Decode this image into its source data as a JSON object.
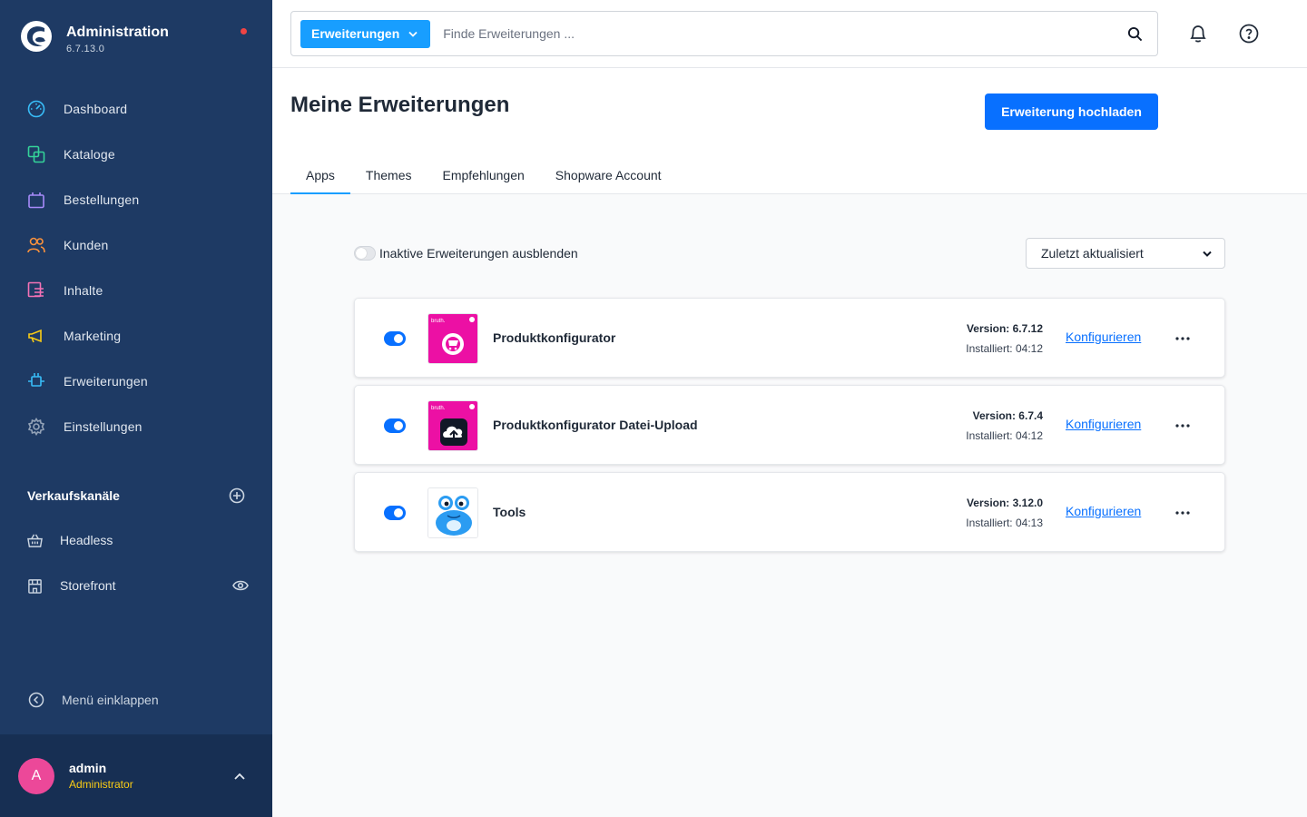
{
  "app": {
    "title": "Administration",
    "version": "6.7.13.0"
  },
  "colors": {
    "sidebar": "#1e3a64",
    "primary": "#0870ff",
    "accent": "#189eff",
    "avatar": "#ec4899",
    "role": "#facc15"
  },
  "sidebar": {
    "items": [
      {
        "label": "Dashboard",
        "icon": "dashboard-icon"
      },
      {
        "label": "Kataloge",
        "icon": "catalog-icon"
      },
      {
        "label": "Bestellungen",
        "icon": "orders-icon"
      },
      {
        "label": "Kunden",
        "icon": "customers-icon"
      },
      {
        "label": "Inhalte",
        "icon": "content-icon"
      },
      {
        "label": "Marketing",
        "icon": "marketing-icon"
      },
      {
        "label": "Erweiterungen",
        "icon": "extensions-icon"
      },
      {
        "label": "Einstellungen",
        "icon": "settings-icon"
      }
    ],
    "channels_title": "Verkaufskanäle",
    "channels": [
      {
        "label": "Headless",
        "icon": "basket-icon"
      },
      {
        "label": "Storefront",
        "icon": "storefront-icon"
      }
    ],
    "collapse_label": "Menü einklappen"
  },
  "user": {
    "initial": "A",
    "name": "admin",
    "role": "Administrator"
  },
  "search": {
    "type_label": "Erweiterungen",
    "placeholder": "Finde Erweiterungen ..."
  },
  "page": {
    "title": "Meine Erweiterungen",
    "upload_label": "Erweiterung hochladen",
    "tabs": [
      {
        "label": "Apps"
      },
      {
        "label": "Themes"
      },
      {
        "label": "Empfehlungen"
      },
      {
        "label": "Shopware Account"
      }
    ]
  },
  "filter": {
    "hide_inactive_label": "Inaktive Erweiterungen ausblenden",
    "sort_label": "Zuletzt aktualisiert"
  },
  "extensions": [
    {
      "name": "Produktkonfigurator",
      "version": "Version: 6.7.12",
      "installed": "Installiert: 04:12",
      "configure": "Konfigurieren",
      "icon_badge": "bruth."
    },
    {
      "name": "Produktkonfigurator Datei-Upload",
      "version": "Version: 6.7.4",
      "installed": "Installiert: 04:12",
      "configure": "Konfigurieren",
      "icon_badge": "bruth."
    },
    {
      "name": "Tools",
      "version": "Version: 3.12.0",
      "installed": "Installiert: 04:13",
      "configure": "Konfigurieren"
    }
  ]
}
